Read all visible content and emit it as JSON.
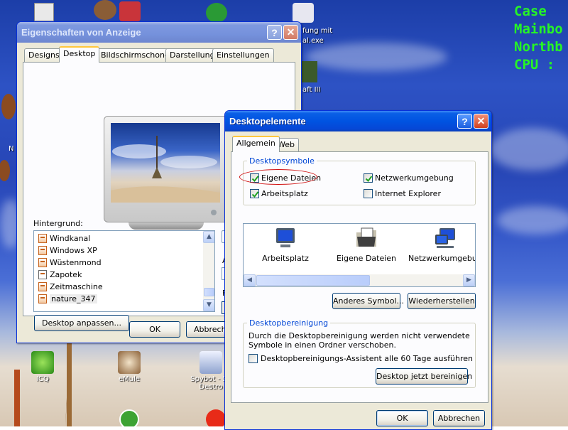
{
  "desktop": {
    "case_info": [
      "Case",
      "Mainbo",
      "Northb",
      "CPU :"
    ],
    "icons": [
      {
        "label": "ICQ"
      },
      {
        "label": "eMule"
      },
      {
        "label": "Spybot - Se Destro"
      }
    ],
    "partial_labels": {
      "left_n": "N",
      "fung_mit": "fung mit",
      "al_exe": "al.exe",
      "aft_iii": "aft III"
    }
  },
  "display_properties": {
    "title": "Eigenschaften von Anzeige",
    "tabs": [
      "Designs",
      "Desktop",
      "Bildschirmschoner",
      "Darstellung",
      "Einstellungen"
    ],
    "background_label": "Hintergrund:",
    "backgrounds": [
      "Windkanal",
      "Windows XP",
      "Wüstenmond",
      "Zapotek",
      "Zeitmaschine",
      "nature_347"
    ],
    "selected_background": "nature_347",
    "customize_button": "Desktop anpassen...",
    "partial_labels": [
      "A",
      "F"
    ],
    "ok_button": "OK",
    "cancel_button": "Abbrechen"
  },
  "desktop_items": {
    "title": "Desktopelemente",
    "tabs": [
      "Allgemein",
      "Web"
    ],
    "desktop_icons_group": "Desktopsymbole",
    "checkboxes": [
      {
        "label": "Eigene Dateien",
        "checked": true
      },
      {
        "label": "Netzwerkumgebung",
        "checked": true
      },
      {
        "label": "Arbeitsplatz",
        "checked": true
      },
      {
        "label": "Internet Explorer",
        "checked": false
      }
    ],
    "icon_previews": [
      {
        "label": "Arbeitsplatz",
        "icon": "my-computer-icon"
      },
      {
        "label": "Eigene Dateien",
        "icon": "my-documents-icon"
      },
      {
        "label": "Netzwerkumgebur",
        "icon": "network-places-icon"
      }
    ],
    "change_icon_button": "Anderes Symbol...",
    "restore_button": "Wiederherstellen",
    "cleanup_group": "Desktopbereinigung",
    "cleanup_text": [
      "Durch die Desktopbereinigung werden nicht verwendete",
      "Symbole in einen Ordner verschoben."
    ],
    "cleanup_checkbox": {
      "label": "Desktopbereinigungs-Assistent alle 60 Tage ausführen",
      "checked": false
    },
    "cleanup_now_button": "Desktop jetzt bereinigen",
    "ok_button": "OK",
    "cancel_button": "Abbrechen"
  },
  "colors": {
    "xp_blue": "#0054e3",
    "case_text": "#26f526",
    "group_title": "#0046d5",
    "highlight_ellipse": "#d01010"
  }
}
